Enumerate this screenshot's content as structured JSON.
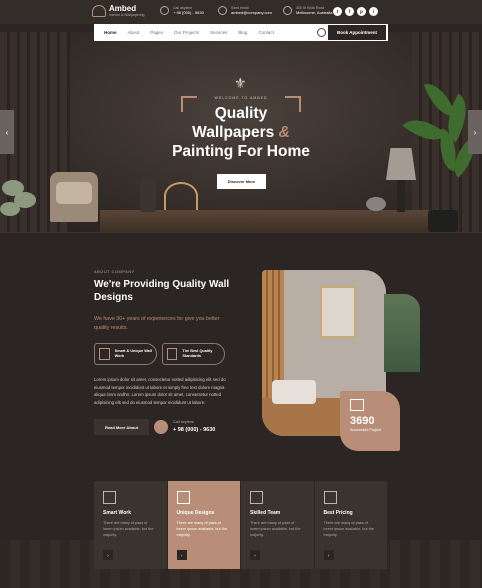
{
  "brand": {
    "name": "Ambed",
    "tagline": "Interior & Wallpapering"
  },
  "topbar": {
    "contacts": [
      {
        "icon": "phone-icon",
        "label": "Call anytime",
        "value": "+ 98 (000) - 9630"
      },
      {
        "icon": "mail-icon",
        "label": "Send email",
        "value": "ambed@company.com"
      },
      {
        "icon": "location-icon",
        "label": "380 St Kilda Road",
        "value": "Melbourne, Australia"
      }
    ],
    "socials": [
      "t",
      "f",
      "p",
      "i"
    ]
  },
  "nav": {
    "items": [
      "Home",
      "About",
      "Pages",
      "Our Projects",
      "Services",
      "Blog",
      "Contact"
    ],
    "active": "Home",
    "cta": "Book Appointment"
  },
  "hero": {
    "pre": "WELCOME TO AMBED",
    "title_l1": "Quality",
    "title_l2": "Wallpapers",
    "title_amp": "&",
    "title_l3": "Painting For Home",
    "button": "Discover More"
  },
  "about": {
    "sub": "ABOUT COMPANY",
    "title": "We're Providing Quality Wall Designs",
    "lead": "We have 30+ years of experiences for give you better quality results.",
    "pills": [
      "Smart & Unique Wall Work",
      "The Best Quality Standards"
    ],
    "body": "Lorem ipsum dolor sit amet, consectetur notted adipisicing elit sed do eiusmod tempor incididunt ut labore et simply free text dolore magna aliqua lonm andhn. Lorem ipsum dolor sit amet, consectetur notted adipisicing elit sed do eiusmod tempor incididunt ut labore.",
    "button": "Read More About",
    "call_label": "Call anytime",
    "call_value": "+ 98 (000) - 9630",
    "stat_value": "3690",
    "stat_label": "Successful Project"
  },
  "features": [
    {
      "icon": "house-brush-icon",
      "title": "Smart Work",
      "desc": "There are many of pass of lorem ipsum available, but the majority."
    },
    {
      "icon": "paint-roller-icon",
      "title": "Unique Designs",
      "desc": "There are many of pass of lorem ipsum available, but the majority."
    },
    {
      "icon": "team-icon",
      "title": "Skilled Team",
      "desc": "There are many of pass of lorem ipsum available, but the majority."
    },
    {
      "icon": "price-tag-icon",
      "title": "Best Pricing",
      "desc": "There are many of pass of lorem ipsum available, but the majority."
    }
  ],
  "colors": {
    "accent": "#b98e78",
    "dark": "#2b2624",
    "panel": "#3a3330"
  }
}
